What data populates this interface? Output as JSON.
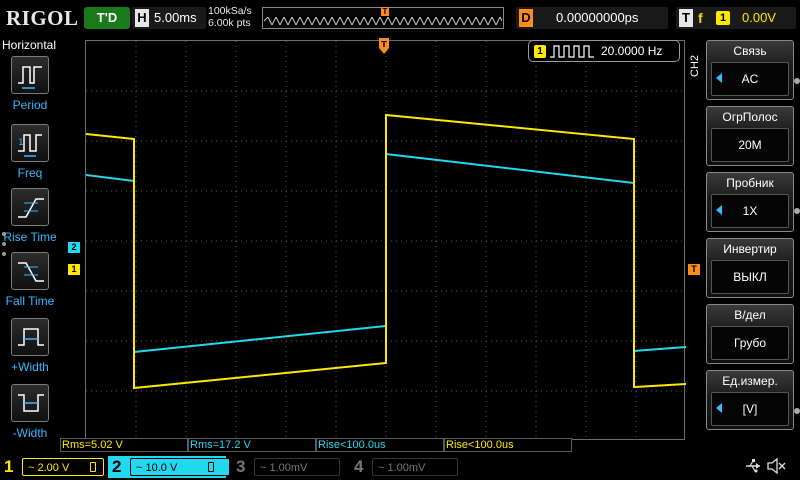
{
  "brand": "RIGOL",
  "top": {
    "trigger_status": "T'D",
    "timebase_letter": "H",
    "timebase": "5.00ms",
    "sample_rate": "100kSa/s",
    "memory_depth": "6.00k pts",
    "delay_letter": "D",
    "delay": "0.00000000ps",
    "trigger_letter": "T",
    "trigger_edge": "f",
    "trigger_source": "1",
    "trigger_level": "0.00V"
  },
  "left_menu": {
    "title": "Horizontal",
    "items": [
      {
        "label": "Period",
        "icon": "period-icon"
      },
      {
        "label": "Freq",
        "icon": "freq-icon"
      },
      {
        "label": "Rise Time",
        "icon": "rise-time-icon"
      },
      {
        "label": "Fall Time",
        "icon": "fall-time-icon"
      },
      {
        "label": "+Width",
        "icon": "pos-width-icon"
      },
      {
        "label": "-Width",
        "icon": "neg-width-icon"
      }
    ]
  },
  "freq_counter": {
    "channel": "1",
    "value": "20.0000 Hz"
  },
  "markers": {
    "ch1": "1",
    "ch2": "2",
    "trigger": "T"
  },
  "right_menu": {
    "channel_tag": "CH2",
    "items": [
      {
        "title": "Связь",
        "value": "AC",
        "has_arrow": true
      },
      {
        "title": "ОгрПолос",
        "value": "20M",
        "has_arrow": false
      },
      {
        "title": "Пробник",
        "value": "1X",
        "has_arrow": true
      },
      {
        "title": "Инвертир",
        "value": "ВЫКЛ",
        "has_arrow": false
      },
      {
        "title": "В/дел",
        "value": "Грубо",
        "has_arrow": false
      },
      {
        "title": "Ед.измер.",
        "value": "[V]",
        "has_arrow": true
      }
    ]
  },
  "measurements": [
    {
      "text": "Rms=5.02 V",
      "color": "#ffe800"
    },
    {
      "text": "Rms=17.2 V",
      "color": "#22d8ee"
    },
    {
      "text": "Rise<100.0us",
      "color": "#22d8ee"
    },
    {
      "text": "Rise<100.0us",
      "color": "#ffe800"
    }
  ],
  "channels": [
    {
      "num": "1",
      "scale": "~ 2.00 V",
      "color": "#ffe800",
      "active": true
    },
    {
      "num": "2",
      "scale": "~ 10.0 V",
      "color": "#22d8ee",
      "active": true
    },
    {
      "num": "3",
      "scale": "~ 1.00mV",
      "color": "#777777",
      "active": false
    },
    {
      "num": "4",
      "scale": "~   1.00mV",
      "color": "#777777",
      "active": false
    }
  ],
  "colors": {
    "ch1": "#ffe800",
    "ch2": "#22d8ee",
    "trigger": "#ff8c1a",
    "menu_accent": "#38b8ff"
  }
}
